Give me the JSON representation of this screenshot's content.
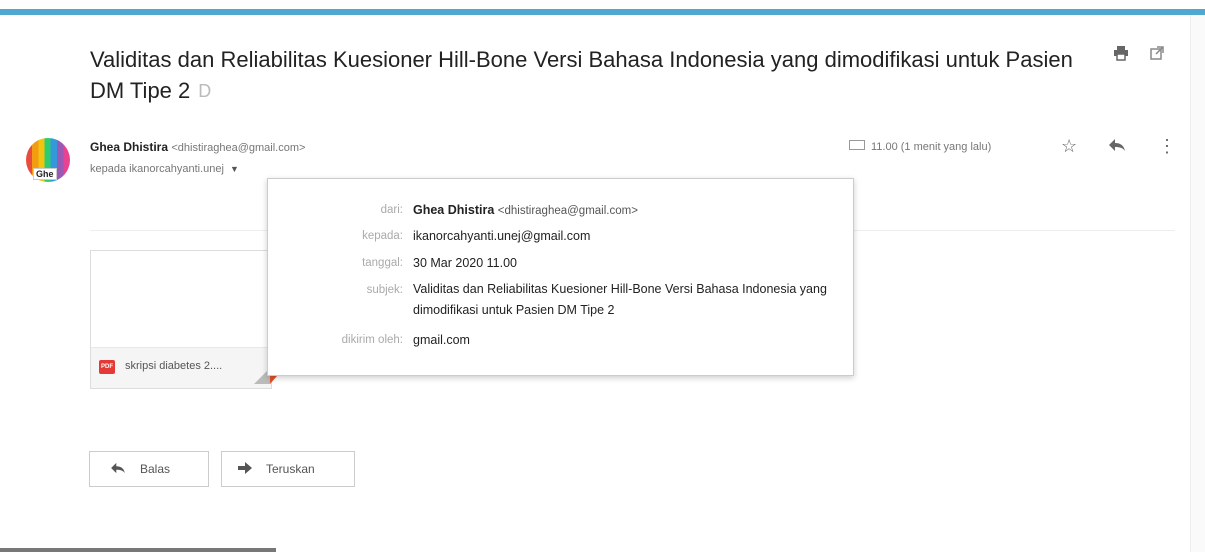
{
  "message": {
    "subject": "Validitas dan Reliabilitas Kuesioner Hill-Bone Versi Bahasa Indonesia yang dimodifikasi untuk Pasien DM Tipe 2",
    "label_icon": "D",
    "sender_name": "Ghea Dhistira",
    "sender_email": "<dhistiraghea@gmail.com>",
    "to_line": "kepada ikanorcahyanti.unej",
    "time_text": "11.00 (1 menit yang lalu)",
    "avatar_tag": "Ghe"
  },
  "details": {
    "from_label": "dari:",
    "from_name": "Ghea Dhistira",
    "from_email": "<dhistiraghea@gmail.com>",
    "to_label": "kepada:",
    "to_value": "ikanorcahyanti.unej@gmail.com",
    "date_label": "tanggal:",
    "date_value": "30 Mar 2020 11.00",
    "subject_label": "subjek:",
    "subject_value": "Validitas dan Reliabilitas Kuesioner Hill-Bone Versi Bahasa Indonesia yang dimodifikasi untuk Pasien DM Tipe 2",
    "mailedby_label": "dikirim oleh:",
    "mailedby_value": "gmail.com"
  },
  "attachment": {
    "type_label": "PDF",
    "filename": "skripsi diabetes 2...."
  },
  "actions": {
    "reply_label": "Balas",
    "forward_label": "Teruskan"
  },
  "icons": {
    "print": "print-icon",
    "popout": "open-in-new-icon",
    "star": "star-icon",
    "reply": "reply-icon",
    "more": "more-vert-icon"
  }
}
